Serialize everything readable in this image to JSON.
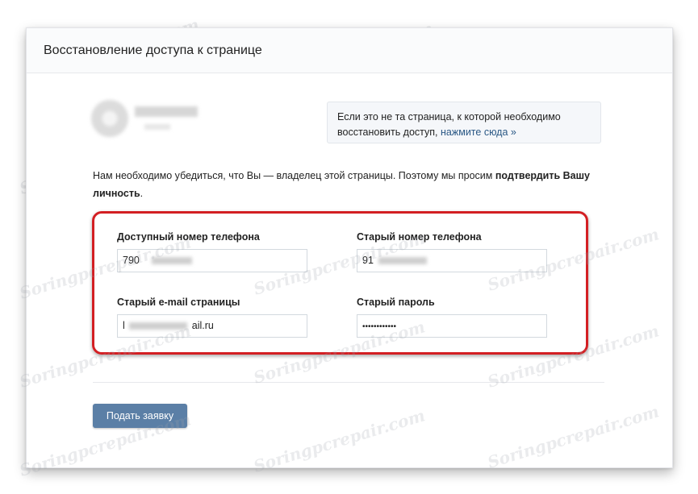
{
  "header": {
    "title": "Восстановление доступа к странице"
  },
  "notice": {
    "text": "Если это не та страница, к которой необходимо восстановить доступ,",
    "link": "нажмите сюда »"
  },
  "intro": {
    "text": "Нам необходимо убедиться, что Вы — владелец этой страницы. Поэтому мы просим",
    "bold": "подтвердить Вашу личность",
    "end": "."
  },
  "fields": {
    "phone": {
      "label": "Доступный номер телефона",
      "value": "790"
    },
    "old_phone": {
      "label": "Старый номер телефона",
      "value": "91"
    },
    "old_email": {
      "label": "Старый e-mail страницы",
      "value": "l",
      "value_tail": "ail.ru"
    },
    "old_password": {
      "label": "Старый пароль",
      "value": "••••••••••••"
    }
  },
  "submit": {
    "label": "Подать заявку"
  },
  "watermark": "Soringpcrepair.com",
  "colors": {
    "accent": "#5b7fa6",
    "link": "#2a5885",
    "highlight": "#d31f23"
  }
}
